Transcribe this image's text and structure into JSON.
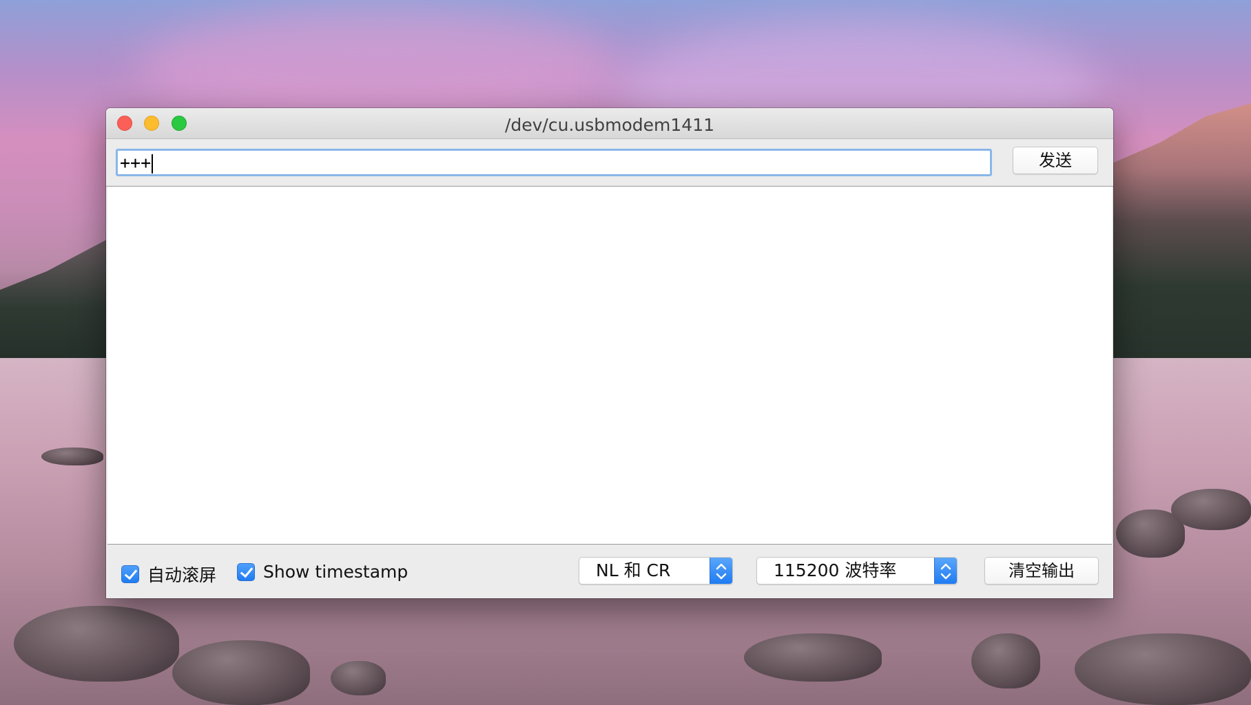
{
  "window": {
    "title": "/dev/cu.usbmodem1411"
  },
  "toolbar": {
    "input_value": "+++",
    "send_label": "发送"
  },
  "output": {
    "text": ""
  },
  "statusbar": {
    "autoscroll_label": "自动滚屏",
    "autoscroll_checked": true,
    "timestamp_label": "Show timestamp",
    "timestamp_checked": true,
    "line_ending_value": "NL 和 CR",
    "baud_rate_value": "115200 波特率",
    "clear_label": "清空输出"
  },
  "colors": {
    "accent": "#1f7cf2",
    "close": "#fc5f57",
    "minimize": "#fdbc2e",
    "maximize": "#29c941",
    "focus_ring": "#8ab6ea"
  }
}
